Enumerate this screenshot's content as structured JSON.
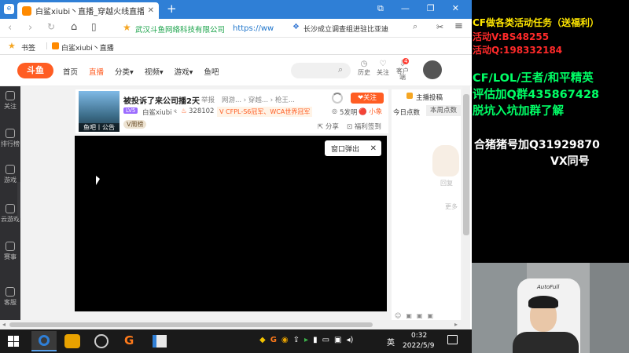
{
  "browser": {
    "tab_title": "白鲨xiubi丶直播_穿越火线直播_斗鱼",
    "new_tab": "+",
    "window_controls": [
      "⧉",
      "—",
      "❐",
      "✕"
    ],
    "cert_org": "武汉斗鱼网络科技有限公司",
    "url": "https://ww",
    "search_hint": "长沙成立调查组进驻比亚迪",
    "bookmarks_label": "书签",
    "bookmark_item": "白鲨xiubi丶直播"
  },
  "site": {
    "logo": "斗鱼",
    "nav": [
      "首页",
      "直播",
      "分类▾",
      "视频▾",
      "游戏▾",
      "鱼吧"
    ],
    "active_nav": "直播",
    "header_icons": [
      {
        "icon": "history-icon",
        "label": "历史"
      },
      {
        "icon": "heart-icon",
        "label": "关注"
      },
      {
        "icon": "download-icon",
        "label": "客户端"
      }
    ],
    "notif_badge": "4"
  },
  "leftnav": [
    "关注",
    "排行榜",
    "游戏",
    "云游戏",
    "赛事",
    "客服"
  ],
  "room": {
    "title": "被投诉了来公司播2天",
    "report": "举报",
    "crumbs": "网游... › 穿越... › 枪王...",
    "follow_btn": "❤关注",
    "streamer": "白鲨xiubi丶",
    "level_badge": "LV5",
    "heat": "328102",
    "tags": "V CFPL-S6冠军、WCA世界冠军",
    "tag_hint": "🔴 小象",
    "fish_label": "鱼吧丨公告",
    "vrank": "V周榜",
    "viewers": "5发明",
    "share": "分享",
    "welfare": "福利签到"
  },
  "player": {
    "popup": "窗口弹出",
    "popup_close": "✕"
  },
  "sidepanel": {
    "header": "主播投稿",
    "tabs": [
      "今日点数",
      "本周点数"
    ],
    "active_tab": "本周点数",
    "reply": "回复",
    "more": "更多"
  },
  "taskbar": {
    "time": "0:32",
    "date": "2022/5/9",
    "ime": "英"
  },
  "stream": {
    "promo_lines": [
      {
        "text": "CF做各类活动任务（送福利）",
        "color": "#ffe600"
      },
      {
        "text": "活动V:BS48255",
        "color": "#ff2a2a"
      },
      {
        "text": "活动Q:198332184",
        "color": "#ff2a2a"
      },
      {
        "text": "CF/LOL/王者/和平精英",
        "color": "#00ff66"
      },
      {
        "text": "评估加Q群435867428",
        "color": "#00ff66"
      },
      {
        "text": "脱坑入坑加群了解",
        "color": "#00ff66"
      },
      {
        "text": "合猪猪号加Q31929870",
        "color": "#ffffff"
      },
      {
        "text": "VX同号",
        "color": "#ffffff"
      }
    ],
    "chair_brand": "AutoFull"
  },
  "colors": {
    "accent": "#ff5d23",
    "tabbar": "#2f7fd6",
    "cert_green": "#1aa34a",
    "url_blue": "#2277cc"
  }
}
